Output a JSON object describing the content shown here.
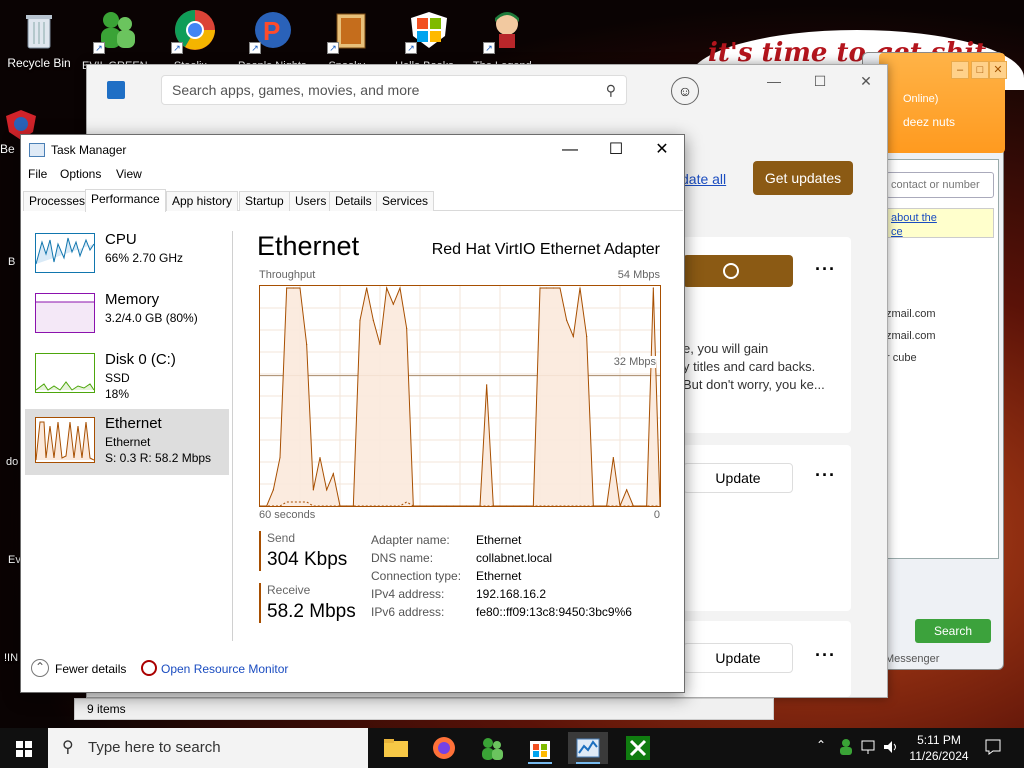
{
  "desktop": {
    "recycle_bin": "Recycle Bin",
    "top_icons": [
      {
        "label": "EVIL GREEN...",
        "color": "#3aa336"
      },
      {
        "label": "Steelix...",
        "color": "#e34133"
      },
      {
        "label": "People Nights...",
        "color": "#ff7a00"
      },
      {
        "label": "Spooky...",
        "color": "#c56d1c"
      },
      {
        "label": "Hello Books...",
        "color": "#f25022"
      },
      {
        "label": "The Legend...",
        "color": "#2a62b9"
      }
    ],
    "left_labels": [
      "Be",
      "B",
      "do",
      "Ev",
      "!IN"
    ],
    "banner_text": "it's time to get shit",
    "messenger": {
      "status_online": "Online)",
      "nickname": "deez nuts",
      "search_placeholder": "contact or number",
      "link_text_1": "about the",
      "link_text_2": "ce",
      "email1": "zmail.com",
      "email2": "zmail.com",
      "item3": "r cube",
      "search_button": "Search",
      "footer": "Messenger"
    }
  },
  "store": {
    "search_placeholder": "Search apps, games, movies, and more",
    "update_all": "date all",
    "get_updates": "Get updates",
    "desc_line1": "e, you will gain",
    "desc_line2": "y titles and card backs.",
    "desc_line3": "But don't worry, you ke...",
    "update_label": "Update",
    "update_label2": "Update",
    "items_count": "9 items"
  },
  "taskmanager": {
    "title": "Task Manager",
    "menu": [
      "File",
      "Options",
      "View"
    ],
    "tabs": [
      "Processes",
      "Performance",
      "App history",
      "Startup",
      "Users",
      "Details",
      "Services"
    ],
    "side": {
      "cpu": {
        "name": "CPU",
        "sub": "66%  2.70 GHz"
      },
      "memory": {
        "name": "Memory",
        "sub": "3.2/4.0 GB (80%)"
      },
      "disk": {
        "name": "Disk 0 (C:)",
        "sub1": "SSD",
        "sub2": "18%"
      },
      "ethernet": {
        "name": "Ethernet",
        "sub1": "Ethernet",
        "sub2": "S: 0.3  R: 58.2 Mbps"
      }
    },
    "panel": {
      "title": "Ethernet",
      "adapter": "Red Hat VirtIO Ethernet Adapter",
      "throughput_label": "Throughput",
      "max_label": "54 Mbps",
      "mid_label": "32 Mbps",
      "time_label": "60 seconds",
      "zero_label": "0",
      "send_label": "Send",
      "send_value": "304 Kbps",
      "receive_label": "Receive",
      "receive_value": "58.2 Mbps",
      "info": [
        {
          "label": "Adapter name:",
          "value": "Ethernet"
        },
        {
          "label": "DNS name:",
          "value": "collabnet.local"
        },
        {
          "label": "Connection type:",
          "value": "Ethernet"
        },
        {
          "label": "IPv4 address:",
          "value": "192.168.16.2"
        },
        {
          "label": "IPv6 address:",
          "value": "fe80::ff09:13c8:9450:3bc9%6"
        }
      ]
    },
    "footer": {
      "fewer_details": "Fewer details",
      "open_resmon": "Open Resource Monitor"
    },
    "graph_color": "#a74f01",
    "graph_fill": "#fbe9dc"
  },
  "chart_data": {
    "type": "area",
    "title": "Throughput",
    "ylim": [
      0,
      54
    ],
    "x": [
      0,
      1,
      2,
      3,
      4,
      5,
      6,
      7,
      8,
      9,
      10,
      11,
      12,
      13,
      14,
      15,
      16,
      17,
      18,
      19,
      20,
      21,
      22,
      23,
      24,
      25,
      26,
      27,
      28,
      29,
      30,
      31,
      32,
      33,
      34,
      35,
      36,
      37,
      38,
      39,
      40,
      41,
      42,
      43,
      44,
      45,
      46,
      47,
      48,
      49,
      50,
      51,
      52,
      53,
      54,
      55,
      56,
      57,
      58,
      59,
      60
    ],
    "values": [
      0,
      0,
      4,
      12,
      54,
      54,
      54,
      40,
      4,
      12,
      4,
      8,
      0,
      0,
      0,
      46,
      54,
      46,
      40,
      54,
      50,
      54,
      44,
      0,
      0,
      0,
      0,
      0,
      0,
      0,
      0,
      0,
      0,
      0,
      30,
      0,
      0,
      0,
      0,
      0,
      0,
      0,
      54,
      54,
      54,
      54,
      46,
      42,
      54,
      42,
      0,
      0,
      0,
      12,
      0,
      4,
      0,
      0,
      0,
      54,
      0
    ],
    "series": [
      {
        "name": "",
        "values": [
          0,
          0,
          0,
          0,
          1,
          1,
          1,
          1,
          0,
          0,
          0,
          0,
          0,
          0,
          0,
          0,
          0,
          0,
          0,
          0,
          0,
          0,
          1,
          0,
          0,
          0,
          0,
          0,
          0,
          0,
          0,
          0,
          0,
          0,
          0,
          0,
          0,
          0,
          0,
          0,
          0,
          0,
          0,
          0,
          0,
          0,
          0,
          0,
          0,
          0,
          0,
          0,
          0,
          0,
          0,
          0,
          0,
          0,
          0,
          0,
          0
        ]
      }
    ]
  },
  "taskbar": {
    "search_placeholder": "Type here to search",
    "time": "5:11 PM",
    "date": "11/26/2024"
  }
}
